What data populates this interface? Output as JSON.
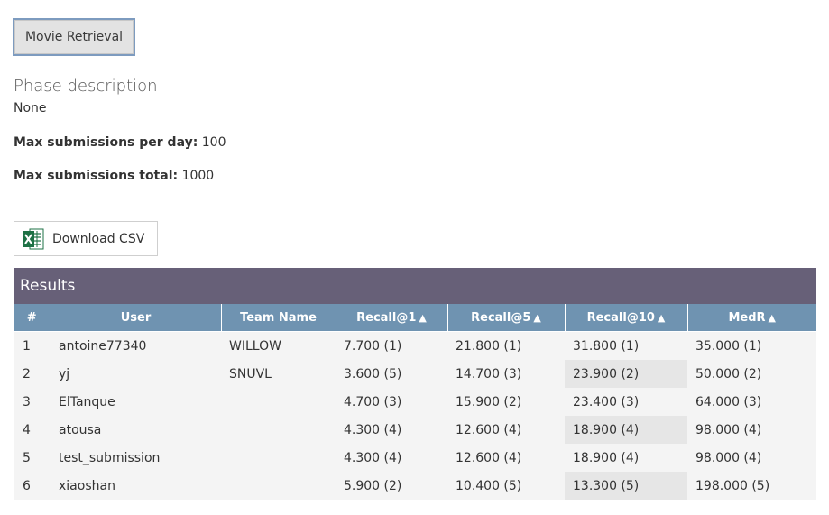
{
  "phase": {
    "button_label": "Movie Retrieval",
    "title": "Phase description",
    "description": "None"
  },
  "limits": {
    "per_day_label": "Max submissions per day:",
    "per_day_value": "100",
    "total_label": "Max submissions total:",
    "total_value": "1000"
  },
  "download": {
    "label": "Download CSV",
    "icon": "excel-icon"
  },
  "results": {
    "title": "Results",
    "columns": [
      "#",
      "User",
      "Team Name",
      "Recall@1",
      "Recall@5",
      "Recall@10",
      "MedR"
    ],
    "sort_arrow": "▲",
    "rows": [
      {
        "rank": "1",
        "user": "antoine77340",
        "team": "WILLOW",
        "r1": "7.700 (1)",
        "r5": "21.800 (1)",
        "r10": "31.800 (1)",
        "medr": "35.000 (1)"
      },
      {
        "rank": "2",
        "user": "yj",
        "team": "SNUVL",
        "r1": "3.600 (5)",
        "r5": "14.700 (3)",
        "r10": "23.900 (2)",
        "medr": "50.000 (2)"
      },
      {
        "rank": "3",
        "user": "ElTanque",
        "team": "",
        "r1": "4.700 (3)",
        "r5": "15.900 (2)",
        "r10": "23.400 (3)",
        "medr": "64.000 (3)"
      },
      {
        "rank": "4",
        "user": "atousa",
        "team": "",
        "r1": "4.300 (4)",
        "r5": "12.600 (4)",
        "r10": "18.900 (4)",
        "medr": "98.000 (4)"
      },
      {
        "rank": "5",
        "user": "test_submission",
        "team": "",
        "r1": "4.300 (4)",
        "r5": "12.600 (4)",
        "r10": "18.900 (4)",
        "medr": "98.000 (4)"
      },
      {
        "rank": "6",
        "user": "xiaoshan",
        "team": "",
        "r1": "5.900 (2)",
        "r5": "10.400 (5)",
        "r10": "13.300 (5)",
        "medr": "198.000 (5)"
      }
    ]
  },
  "colors": {
    "results_header_bg": "#676078",
    "column_header_bg": "#6f93b1",
    "row_bg": "#f4f4f4",
    "highlight_cell_bg": "#e6e6e6",
    "excel_green": "#1e7145"
  }
}
